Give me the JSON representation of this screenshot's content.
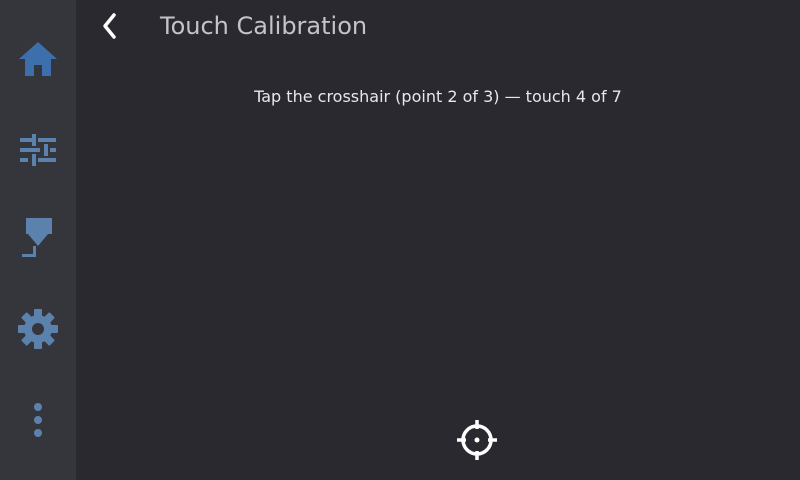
{
  "header": {
    "title": "Touch Calibration",
    "back_icon": "chevron-left-icon"
  },
  "instruction": "Tap the crosshair (point 2 of 3) — touch 4 of 7",
  "sidebar": {
    "items": [
      {
        "id": "home",
        "icon": "home-icon"
      },
      {
        "id": "tune",
        "icon": "sliders-icon"
      },
      {
        "id": "extrude",
        "icon": "extruder-icon"
      },
      {
        "id": "settings",
        "icon": "gear-icon"
      },
      {
        "id": "more",
        "icon": "more-vertical-icon"
      }
    ]
  },
  "target": {
    "icon": "crosshair-icon"
  },
  "colors": {
    "background": "#2a292f",
    "sidebar": "#35363c",
    "nav_icon": "#5b82ad",
    "home_active": "#3e6fad",
    "text": "#e8e8ea",
    "title": "#c4c4c8",
    "crosshair": "#ffffff"
  }
}
